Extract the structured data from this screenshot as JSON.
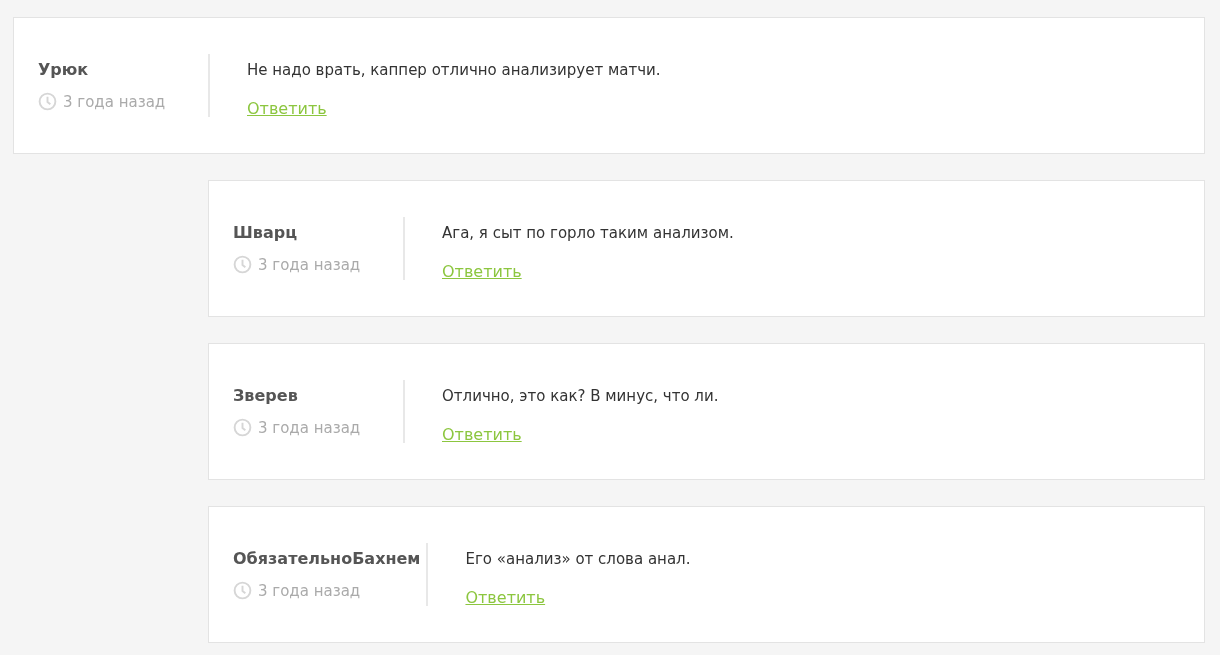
{
  "comments": [
    {
      "author": "Урюк",
      "time": "3 года назад",
      "text": "Не надо врать, каппер отлично анализирует матчи.",
      "reply": "Ответить",
      "children": [
        {
          "author": "Шварц",
          "time": "3 года назад",
          "text": "Ага, я сыт по горло таким анализом.",
          "reply": "Ответить"
        },
        {
          "author": "Зверев",
          "time": "3 года назад",
          "text": "Отлично, это как? В минус, что ли.",
          "reply": "Ответить"
        },
        {
          "author": "ОбязательноБахнем",
          "time": "3 года назад",
          "text": "Его «анализ» от слова анал.",
          "reply": "Ответить"
        }
      ]
    }
  ]
}
